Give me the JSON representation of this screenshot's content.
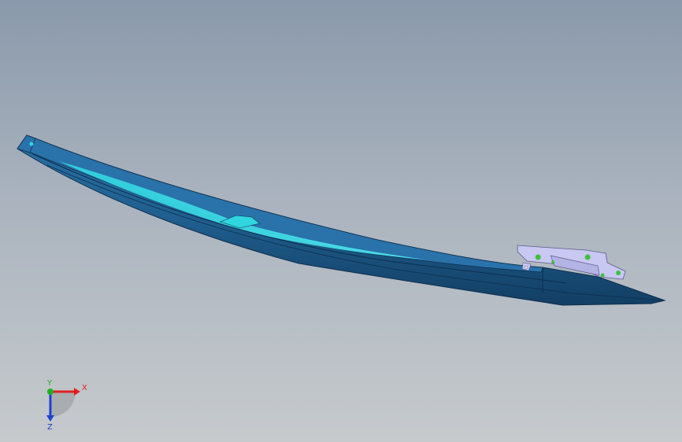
{
  "axes": {
    "x_label": "X",
    "y_label": "Y",
    "z_label": "Z"
  },
  "colors": {
    "background_top": "#8a99ab",
    "background_bottom": "#c6cacd",
    "part_body": "#1f5e8e",
    "part_dark": "#123e63",
    "part_highlight": "#2fd6e0",
    "bracket": "#c9c8f2",
    "bracket_hole": "#3fbf3f",
    "x_axis": "#e02020",
    "y_axis": "#20b020",
    "z_axis": "#2040d0"
  }
}
